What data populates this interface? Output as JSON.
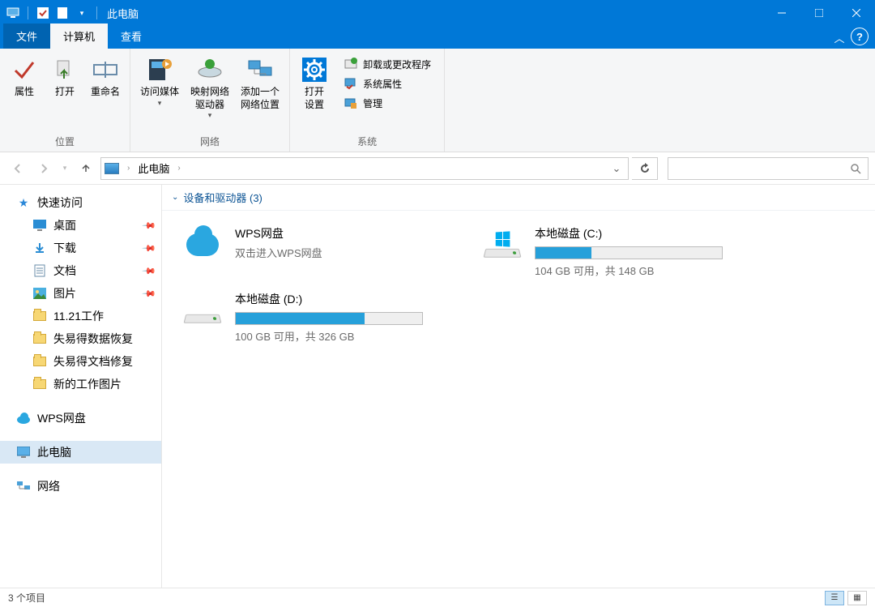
{
  "titlebar": {
    "title": "此电脑"
  },
  "tabs": {
    "file": "文件",
    "computer": "计算机",
    "view": "查看"
  },
  "ribbon": {
    "group_location": "位置",
    "group_network": "网络",
    "group_system": "系统",
    "properties": "属性",
    "open": "打开",
    "rename": "重命名",
    "access_media": "访问媒体",
    "map_drive": "映射网络\n驱动器",
    "add_netloc": "添加一个\n网络位置",
    "open_settings": "打开\n设置",
    "uninstall": "卸载或更改程序",
    "sys_props": "系统属性",
    "manage": "管理"
  },
  "breadcrumb": {
    "root": "此电脑"
  },
  "search": {
    "placeholder": ""
  },
  "sidebar": {
    "quick_access": "快速访问",
    "desktop": "桌面",
    "downloads": "下载",
    "documents": "文档",
    "pictures": "图片",
    "f1": "11.21工作",
    "f2": "失易得数据恢复",
    "f3": "失易得文档修复",
    "f4": "新的工作图片",
    "wps": "WPS网盘",
    "this_pc": "此电脑",
    "network": "网络"
  },
  "category": {
    "header": "设备和驱动器 (3)"
  },
  "drives": {
    "wps": {
      "name": "WPS网盘",
      "sub": "双击进入WPS网盘"
    },
    "c": {
      "name": "本地磁盘 (C:)",
      "sub": "104 GB 可用，共 148 GB",
      "used_pct": 30
    },
    "d": {
      "name": "本地磁盘 (D:)",
      "sub": "100 GB 可用，共 326 GB",
      "used_pct": 69
    }
  },
  "status": {
    "count": "3 个项目"
  }
}
